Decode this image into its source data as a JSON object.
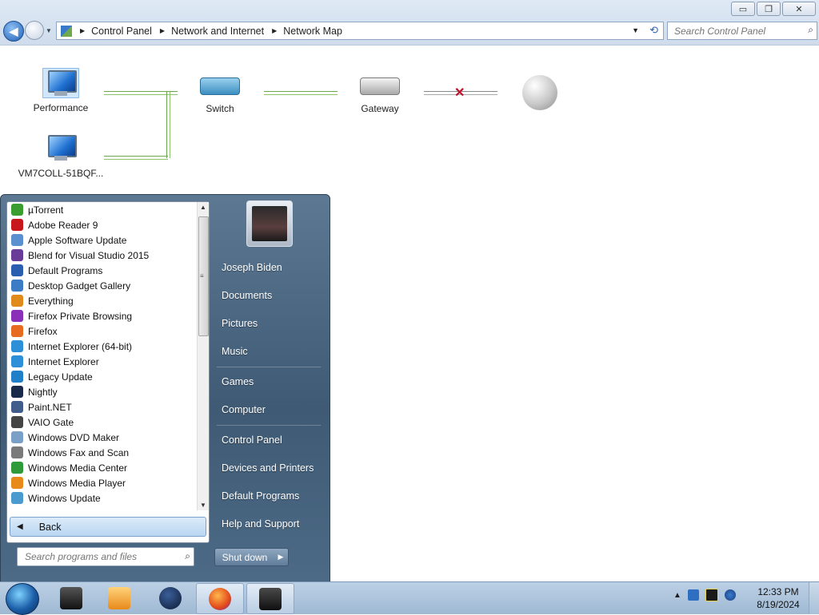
{
  "window": {
    "controls": {
      "minimize": "▭",
      "restore": "❐",
      "close": "✕"
    },
    "breadcrumb": [
      "Control Panel",
      "Network and Internet",
      "Network Map"
    ],
    "search_placeholder": "Search Control Panel"
  },
  "network_map": {
    "nodes": {
      "performance": "Performance",
      "vm": "VM7COLL-51BQF...",
      "switch": "Switch",
      "gateway": "Gateway"
    },
    "broken_link_mark": "✕"
  },
  "start_menu": {
    "programs": [
      {
        "label": "µTorrent",
        "color": "#3a9d2f"
      },
      {
        "label": "Adobe Reader 9",
        "color": "#c8161d"
      },
      {
        "label": "Apple Software Update",
        "color": "#5a8fd0"
      },
      {
        "label": "Blend for Visual Studio 2015",
        "color": "#6a3c99"
      },
      {
        "label": "Default Programs",
        "color": "#2a5fb0"
      },
      {
        "label": "Desktop Gadget Gallery",
        "color": "#3b7cc4"
      },
      {
        "label": "Everything",
        "color": "#e08a1c"
      },
      {
        "label": "Firefox Private Browsing",
        "color": "#8a2fb8"
      },
      {
        "label": "Firefox",
        "color": "#e66a1f"
      },
      {
        "label": "Internet Explorer (64-bit)",
        "color": "#2d8fd8"
      },
      {
        "label": "Internet Explorer",
        "color": "#2d8fd8"
      },
      {
        "label": "Legacy Update",
        "color": "#1f7fc9"
      },
      {
        "label": "Nightly",
        "color": "#1a2a4a"
      },
      {
        "label": "Paint.NET",
        "color": "#3f5c8a"
      },
      {
        "label": "VAIO Gate",
        "color": "#444444"
      },
      {
        "label": "Windows DVD Maker",
        "color": "#7aa0c8"
      },
      {
        "label": "Windows Fax and Scan",
        "color": "#7a7a7a"
      },
      {
        "label": "Windows Media Center",
        "color": "#2f9a3a"
      },
      {
        "label": "Windows Media Player",
        "color": "#e88a1a"
      },
      {
        "label": "Windows Update",
        "color": "#4a9ad0"
      }
    ],
    "back_label": "Back",
    "search_placeholder": "Search programs and files",
    "right_items": {
      "user": "Joseph Biden",
      "documents": "Documents",
      "pictures": "Pictures",
      "music": "Music",
      "games": "Games",
      "computer": "Computer",
      "control_panel": "Control Panel",
      "devices": "Devices and Printers",
      "default_programs": "Default Programs",
      "help": "Help and Support"
    },
    "shutdown_label": "Shut down"
  },
  "taskbar": {
    "time": "12:33 PM",
    "date": "8/19/2024",
    "tray_expand": "▲"
  }
}
